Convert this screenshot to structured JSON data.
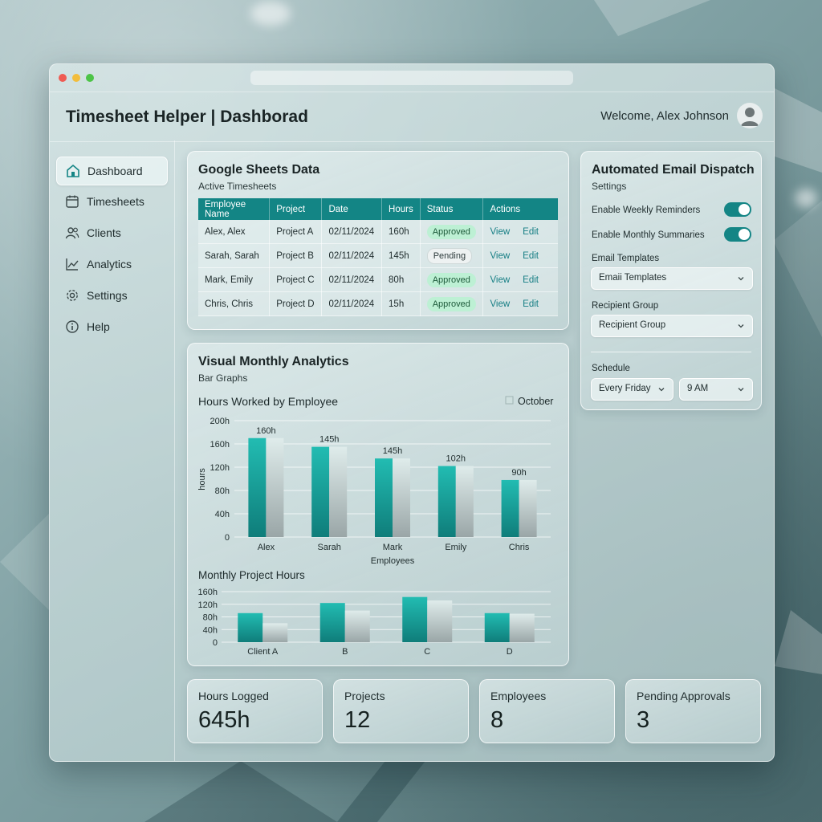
{
  "app": {
    "title": "Timesheet Helper | Dashborad",
    "welcome": "Welcome, Alex Johnson"
  },
  "sidebar": {
    "items": [
      {
        "label": "Dashboard",
        "icon": "home-icon",
        "active": true
      },
      {
        "label": "Timesheets",
        "icon": "calendar-icon"
      },
      {
        "label": "Clients",
        "icon": "users-icon"
      },
      {
        "label": "Analytics",
        "icon": "trend-icon"
      },
      {
        "label": "Settings",
        "icon": "gear-icon"
      },
      {
        "label": "Help",
        "icon": "info-icon"
      }
    ]
  },
  "sheets": {
    "title": "Google Sheets Data",
    "subtitle": "Active Timesheets",
    "columns": [
      "Employee Name",
      "Project",
      "Date",
      "Hours",
      "Status",
      "Actions"
    ],
    "rows": [
      {
        "name": "Alex, Alex",
        "project": "Project A",
        "date": "02/11/2024",
        "hours": "160h",
        "status": "Approved",
        "view": "View",
        "edit": "Edit"
      },
      {
        "name": "Sarah, Sarah",
        "project": "Project B",
        "date": "02/11/2024",
        "hours": "145h",
        "status": "Pending",
        "view": "View",
        "edit": "Edit"
      },
      {
        "name": "Mark, Emily",
        "project": "Project C",
        "date": "02/11/2024",
        "hours": "80h",
        "status": "Approved",
        "view": "View",
        "edit": "Edit"
      },
      {
        "name": "Chris, Chris",
        "project": "Project D",
        "date": "02/11/2024",
        "hours": "15h",
        "status": "Approved",
        "view": "View",
        "edit": "Edit"
      }
    ]
  },
  "email": {
    "title": "Automated Email Dispatch",
    "subtitle": "Settings",
    "weekly_label": "Enable Weekly Reminders",
    "weekly_on": true,
    "monthly_label": "Enable Monthly Summaries",
    "monthly_on": true,
    "templates_label": "Email Templates",
    "templates_value": "Emaii Templates",
    "recipient_label": "Recipient Group",
    "recipient_value": "Recipient Group",
    "schedule_label": "Schedule",
    "schedule_day": "Every Friday",
    "schedule_time": "9 AM"
  },
  "analytics": {
    "title": "Visual Monthly Analytics",
    "subtitle": "Bar Graphs"
  },
  "chart_data": [
    {
      "type": "bar",
      "title": "Hours Worked by Employee",
      "xlabel": "Employees",
      "ylabel": "hours",
      "legend": "October",
      "legend_position": "top-right",
      "categories": [
        "Alex",
        "Sarah",
        "Mark",
        "Emily",
        "Chris"
      ],
      "values": [
        170,
        155,
        135,
        122,
        98
      ],
      "data_labels": [
        "160h",
        "145h",
        "145h",
        "102h",
        "90h"
      ],
      "ylim": [
        0,
        200
      ],
      "yticks": [
        "0",
        "40h",
        "80h",
        "120h",
        "160h",
        "200h"
      ],
      "grid": true,
      "colors": {
        "primary": "#17a79f",
        "secondary": "#cfe0df"
      }
    },
    {
      "type": "bar",
      "title": "Monthly Project Hours",
      "categories": [
        "Client A",
        "B",
        "C",
        "D"
      ],
      "series": [
        {
          "values": [
            92,
            124,
            143,
            92
          ]
        },
        {
          "values": [
            60,
            100,
            132,
            90
          ]
        }
      ],
      "ylim": [
        0,
        160
      ],
      "yticks": [
        "0",
        "40h",
        "80h",
        "120h",
        "160h"
      ],
      "grid": true,
      "colors": {
        "primary": "#17a79f",
        "secondary": "#cfe0df"
      }
    }
  ],
  "stats": [
    {
      "label": "Hours Logged",
      "value": "645h"
    },
    {
      "label": "Projects",
      "value": "12"
    },
    {
      "label": "Employees",
      "value": "8"
    },
    {
      "label": "Pending Approvals",
      "value": "3"
    }
  ]
}
